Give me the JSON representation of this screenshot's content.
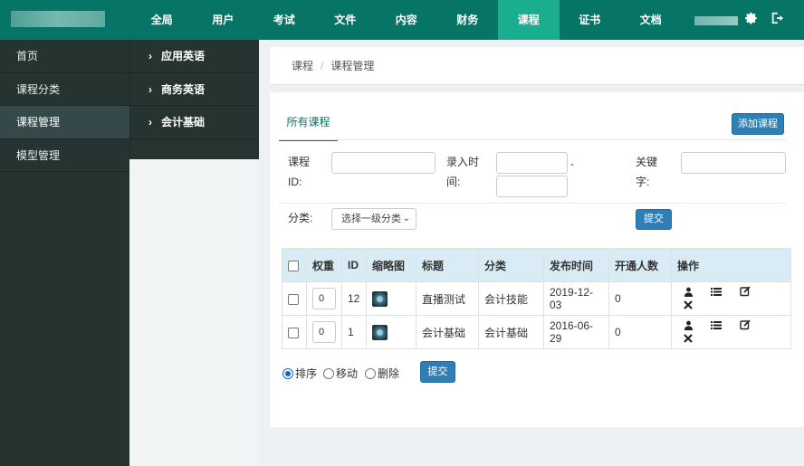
{
  "topnav": {
    "items": [
      "全局",
      "用户",
      "考试",
      "文件",
      "内容",
      "财务",
      "课程",
      "证书",
      "文档"
    ],
    "active_index": 6,
    "settings_icon": "gear-icon",
    "logout_icon": "logout-icon"
  },
  "sidebar": {
    "items": [
      "首页",
      "课程分类",
      "课程管理",
      "模型管理"
    ],
    "active_index": 2
  },
  "submenu": {
    "items": [
      "应用英语",
      "商务英语",
      "会计基础"
    ]
  },
  "breadcrumb": {
    "root": "课程",
    "separator": "/",
    "current": "课程管理"
  },
  "tabs": {
    "active": "所有课程"
  },
  "actions": {
    "add_course": "添加课程"
  },
  "filters": {
    "course_id_label_1": "课程",
    "course_id_label_2": "ID:",
    "entry_time_label_1": "录入时",
    "entry_time_label_2": "间:",
    "range_dash": "-",
    "keyword_label_1": "关键",
    "keyword_label_2": "字:",
    "category_label": "分类:",
    "category_select": "选择一级分类",
    "submit": "提交"
  },
  "table": {
    "headers": [
      "权重",
      "ID",
      "缩略图",
      "标题",
      "分类",
      "发布时间",
      "开通人数",
      "操作"
    ],
    "rows": [
      {
        "weight": "0",
        "id": "12",
        "title": "直播测试",
        "category": "会计技能",
        "published": "2019-12-03",
        "enrolled": "0"
      },
      {
        "weight": "0",
        "id": "1",
        "title": "会计基础",
        "category": "会计基础",
        "published": "2016-06-29",
        "enrolled": "0"
      }
    ],
    "op_icons": [
      "user-icon",
      "list-icon",
      "edit-icon",
      "delete-icon"
    ]
  },
  "bulk": {
    "options": [
      "排序",
      "移动",
      "删除"
    ],
    "selected_index": 0,
    "submit": "提交"
  },
  "colors": {
    "topbar": "#067565",
    "active_nav": "#1aae8f",
    "sidebar": "#253331",
    "primary_button": "#2f7fb7",
    "table_header": "#d9ecf5"
  }
}
